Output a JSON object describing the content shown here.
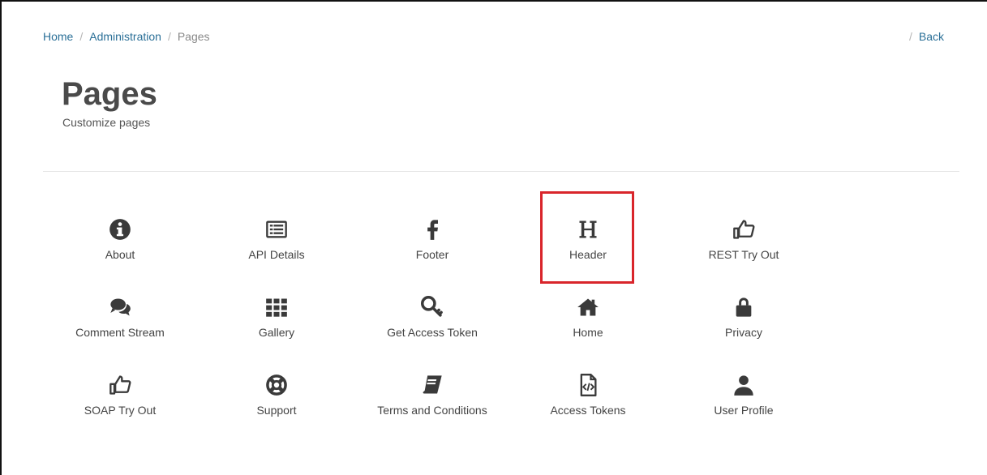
{
  "breadcrumb": {
    "home": "Home",
    "administration": "Administration",
    "current": "Pages",
    "separator": "/"
  },
  "back_label": "Back",
  "page": {
    "title": "Pages",
    "subtitle": "Customize pages"
  },
  "tiles": [
    {
      "label": "About",
      "icon": "info-circle-icon"
    },
    {
      "label": "API Details",
      "icon": "list-card-icon"
    },
    {
      "label": "Footer",
      "icon": "facebook-f-icon"
    },
    {
      "label": "Header",
      "icon": "header-h-icon",
      "highlighted": true
    },
    {
      "label": "REST Try Out",
      "icon": "thumbs-up-pointing-icon"
    },
    {
      "label": "Comment Stream",
      "icon": "comments-icon"
    },
    {
      "label": "Gallery",
      "icon": "grid-icon"
    },
    {
      "label": "Get Access Token",
      "icon": "key-icon"
    },
    {
      "label": "Home",
      "icon": "home-icon"
    },
    {
      "label": "Privacy",
      "icon": "lock-icon"
    },
    {
      "label": "SOAP Try Out",
      "icon": "thumbs-up-pointing-icon"
    },
    {
      "label": "Support",
      "icon": "life-ring-icon"
    },
    {
      "label": "Terms and Conditions",
      "icon": "book-icon"
    },
    {
      "label": "Access Tokens",
      "icon": "code-file-icon"
    },
    {
      "label": "User Profile",
      "icon": "user-icon"
    }
  ],
  "colors": {
    "link": "#2a6f97",
    "highlight": "#d9252b",
    "icon": "#3a3a3a"
  }
}
